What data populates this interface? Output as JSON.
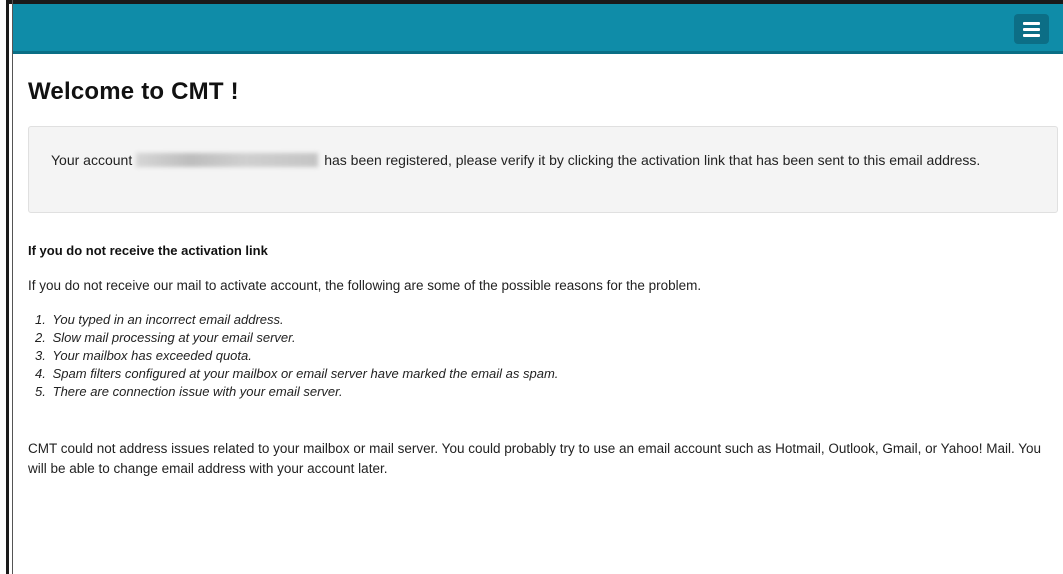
{
  "navbar": {
    "menu_icon": "hamburger-menu-icon",
    "color": "#0f8ca8"
  },
  "page": {
    "title": "Welcome to CMT !"
  },
  "alert": {
    "before": "Your account",
    "after": "has been registered, please verify it by clicking the activation link that has been sent to this email address."
  },
  "help": {
    "heading": "If you do not receive the activation link",
    "intro": "If you do not receive our mail to activate account, the following are some of the possible reasons for the problem.",
    "reasons": [
      {
        "num": "1.",
        "text": "You typed in an incorrect email address."
      },
      {
        "num": "2.",
        "text": "Slow mail processing at your email server."
      },
      {
        "num": "3.",
        "text": "Your mailbox has exceeded quota."
      },
      {
        "num": "4.",
        "text": "Spam filters configured at your mailbox or email server have marked the email as spam."
      },
      {
        "num": "5.",
        "text": "There are connection issue with your email server."
      }
    ],
    "closing": "CMT could not address issues related to your mailbox or mail server. You could probably try to use an email account such as Hotmail, Outlook, Gmail, or Yahoo! Mail. You will be able to change email address with your account later."
  }
}
